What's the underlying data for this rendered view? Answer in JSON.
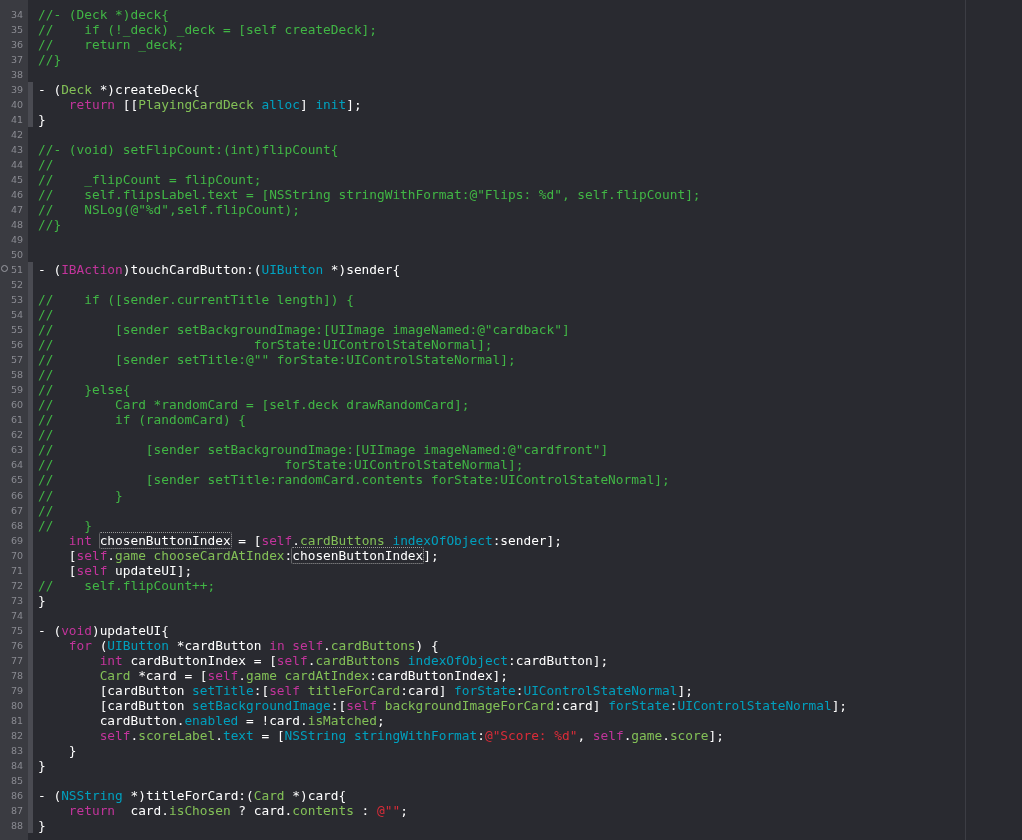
{
  "editor": {
    "lines": [
      {
        "number": "34",
        "marked": false,
        "dot": false,
        "tokens": [
          {
            "kind": "comment",
            "text": "//- (Deck *)deck{"
          }
        ]
      },
      {
        "number": "35",
        "marked": false,
        "dot": false,
        "tokens": [
          {
            "kind": "comment",
            "text": "//    if (!_deck) _deck = [self createDeck];"
          }
        ]
      },
      {
        "number": "36",
        "marked": false,
        "dot": false,
        "tokens": [
          {
            "kind": "comment",
            "text": "//    return _deck;"
          }
        ]
      },
      {
        "number": "37",
        "marked": false,
        "dot": false,
        "tokens": [
          {
            "kind": "comment",
            "text": "//}"
          }
        ]
      },
      {
        "number": "38",
        "marked": false,
        "dot": false
      },
      {
        "number": "39",
        "marked": true,
        "dot": false,
        "tokens": [
          {
            "kind": "plain",
            "text": "- ("
          },
          {
            "kind": "project",
            "text": "Deck"
          },
          {
            "kind": "plain",
            "text": " *)createDeck{"
          }
        ]
      },
      {
        "number": "40",
        "marked": true,
        "dot": false,
        "tokens": [
          {
            "kind": "keyword",
            "text": "    return"
          },
          {
            "kind": "plain",
            "text": " [["
          },
          {
            "kind": "project",
            "text": "PlayingCardDeck "
          },
          {
            "kind": "system",
            "text": "alloc"
          },
          {
            "kind": "plain",
            "text": "] "
          },
          {
            "kind": "system",
            "text": "init"
          },
          {
            "kind": "plain",
            "text": "];"
          }
        ]
      },
      {
        "number": "41",
        "marked": true,
        "dot": false,
        "tokens": [
          {
            "kind": "plain",
            "text": "}"
          }
        ]
      },
      {
        "number": "42",
        "marked": false,
        "dot": false
      },
      {
        "number": "43",
        "marked": false,
        "dot": false,
        "tokens": [
          {
            "kind": "comment",
            "text": "//- (void) setFlipCount:(int)flipCount{"
          }
        ]
      },
      {
        "number": "44",
        "marked": false,
        "dot": false,
        "tokens": [
          {
            "kind": "comment",
            "text": "//"
          }
        ]
      },
      {
        "number": "45",
        "marked": false,
        "dot": false,
        "tokens": [
          {
            "kind": "comment",
            "text": "//    _flipCount = flipCount;"
          }
        ]
      },
      {
        "number": "46",
        "marked": false,
        "dot": false,
        "tokens": [
          {
            "kind": "comment",
            "text": "//    self.flipsLabel.text = [NSString stringWithFormat:@\"Flips: %d\", self.flipCount];"
          }
        ]
      },
      {
        "number": "47",
        "marked": false,
        "dot": false,
        "tokens": [
          {
            "kind": "comment",
            "text": "//    NSLog(@\"%d\",self.flipCount);"
          }
        ]
      },
      {
        "number": "48",
        "marked": false,
        "dot": false,
        "tokens": [
          {
            "kind": "comment",
            "text": "//}"
          }
        ]
      },
      {
        "number": "49",
        "marked": false,
        "dot": false
      },
      {
        "number": "50",
        "marked": false,
        "dot": false
      },
      {
        "number": "51",
        "marked": true,
        "dot": true,
        "tokens": [
          {
            "kind": "plain",
            "text": "- ("
          },
          {
            "kind": "keyword",
            "text": "IBAction"
          },
          {
            "kind": "plain",
            "text": ")touchCardButton:("
          },
          {
            "kind": "system",
            "text": "UIButton"
          },
          {
            "kind": "plain",
            "text": " *)sender{"
          }
        ]
      },
      {
        "number": "52",
        "marked": true,
        "dot": false
      },
      {
        "number": "53",
        "marked": true,
        "dot": false,
        "tokens": [
          {
            "kind": "comment",
            "text": "//    if ([sender.currentTitle length]) {"
          }
        ]
      },
      {
        "number": "54",
        "marked": true,
        "dot": false,
        "tokens": [
          {
            "kind": "comment",
            "text": "//"
          }
        ]
      },
      {
        "number": "55",
        "marked": true,
        "dot": false,
        "tokens": [
          {
            "kind": "comment",
            "text": "//        [sender setBackgroundImage:[UIImage imageNamed:@\"cardback\"]"
          }
        ]
      },
      {
        "number": "56",
        "marked": true,
        "dot": false,
        "tokens": [
          {
            "kind": "comment",
            "text": "//                          forState:UIControlStateNormal];"
          }
        ]
      },
      {
        "number": "57",
        "marked": true,
        "dot": false,
        "tokens": [
          {
            "kind": "comment",
            "text": "//        [sender setTitle:@\"\" forState:UIControlStateNormal];"
          }
        ]
      },
      {
        "number": "58",
        "marked": true,
        "dot": false,
        "tokens": [
          {
            "kind": "comment",
            "text": "//"
          }
        ]
      },
      {
        "number": "59",
        "marked": true,
        "dot": false,
        "tokens": [
          {
            "kind": "comment",
            "text": "//    }else{"
          }
        ]
      },
      {
        "number": "60",
        "marked": true,
        "dot": false,
        "tokens": [
          {
            "kind": "comment",
            "text": "//        Card *randomCard = [self.deck drawRandomCard];"
          }
        ]
      },
      {
        "number": "61",
        "marked": true,
        "dot": false,
        "tokens": [
          {
            "kind": "comment",
            "text": "//        if (randomCard) {"
          }
        ]
      },
      {
        "number": "62",
        "marked": true,
        "dot": false,
        "tokens": [
          {
            "kind": "comment",
            "text": "//"
          }
        ]
      },
      {
        "number": "63",
        "marked": true,
        "dot": false,
        "tokens": [
          {
            "kind": "comment",
            "text": "//            [sender setBackgroundImage:[UIImage imageNamed:@\"cardfront\"]"
          }
        ]
      },
      {
        "number": "64",
        "marked": true,
        "dot": false,
        "tokens": [
          {
            "kind": "comment",
            "text": "//                              forState:UIControlStateNormal];"
          }
        ]
      },
      {
        "number": "65",
        "marked": true,
        "dot": false,
        "tokens": [
          {
            "kind": "comment",
            "text": "//            [sender setTitle:randomCard.contents forState:UIControlStateNormal];"
          }
        ]
      },
      {
        "number": "66",
        "marked": true,
        "dot": false,
        "tokens": [
          {
            "kind": "comment",
            "text": "//        }"
          }
        ]
      },
      {
        "number": "67",
        "marked": true,
        "dot": false,
        "tokens": [
          {
            "kind": "comment",
            "text": "//"
          }
        ]
      },
      {
        "number": "68",
        "marked": true,
        "dot": false,
        "tokens": [
          {
            "kind": "comment",
            "text": "//    }"
          }
        ]
      },
      {
        "number": "69",
        "marked": true,
        "dot": false,
        "tokens": [
          {
            "kind": "keyword",
            "text": "    int "
          },
          {
            "kind": "symbol",
            "text": "chosenButtonIndex"
          },
          {
            "kind": "plain",
            "text": " = ["
          },
          {
            "kind": "keyword",
            "text": "self"
          },
          {
            "kind": "plain",
            "text": "."
          },
          {
            "kind": "project",
            "text": "cardButtons "
          },
          {
            "kind": "system",
            "text": "indexOfObject"
          },
          {
            "kind": "plain",
            "text": ":sender];"
          }
        ]
      },
      {
        "number": "70",
        "marked": true,
        "dot": false,
        "tokens": [
          {
            "kind": "plain",
            "text": "    ["
          },
          {
            "kind": "keyword",
            "text": "self"
          },
          {
            "kind": "plain",
            "text": "."
          },
          {
            "kind": "project",
            "text": "game chooseCardAtIndex"
          },
          {
            "kind": "plain",
            "text": ":"
          },
          {
            "kind": "symbol",
            "text": "chosenButtonIndex"
          },
          {
            "kind": "plain",
            "text": "];"
          }
        ]
      },
      {
        "number": "71",
        "marked": true,
        "dot": false,
        "tokens": [
          {
            "kind": "plain",
            "text": "    ["
          },
          {
            "kind": "keyword",
            "text": "self"
          },
          {
            "kind": "plain",
            "text": " updateUI];"
          }
        ]
      },
      {
        "number": "72",
        "marked": true,
        "dot": false,
        "tokens": [
          {
            "kind": "comment",
            "text": "//    self.flipCount++;"
          }
        ]
      },
      {
        "number": "73",
        "marked": true,
        "dot": false,
        "tokens": [
          {
            "kind": "plain",
            "text": "}"
          }
        ]
      },
      {
        "number": "74",
        "marked": true,
        "dot": false
      },
      {
        "number": "75",
        "marked": true,
        "dot": false,
        "tokens": [
          {
            "kind": "plain",
            "text": "- ("
          },
          {
            "kind": "keyword",
            "text": "void"
          },
          {
            "kind": "plain",
            "text": ")updateUI{"
          }
        ]
      },
      {
        "number": "76",
        "marked": true,
        "dot": false,
        "tokens": [
          {
            "kind": "keyword",
            "text": "    for"
          },
          {
            "kind": "plain",
            "text": " ("
          },
          {
            "kind": "system",
            "text": "UIButton"
          },
          {
            "kind": "plain",
            "text": " *cardButton "
          },
          {
            "kind": "keyword",
            "text": "in self"
          },
          {
            "kind": "plain",
            "text": "."
          },
          {
            "kind": "project",
            "text": "cardButtons"
          },
          {
            "kind": "plain",
            "text": ") {"
          }
        ]
      },
      {
        "number": "77",
        "marked": true,
        "dot": false,
        "tokens": [
          {
            "kind": "keyword",
            "text": "        int"
          },
          {
            "kind": "plain",
            "text": " cardButtonIndex = ["
          },
          {
            "kind": "keyword",
            "text": "self"
          },
          {
            "kind": "plain",
            "text": "."
          },
          {
            "kind": "project",
            "text": "cardButtons "
          },
          {
            "kind": "system",
            "text": "indexOfObject"
          },
          {
            "kind": "plain",
            "text": ":cardButton];"
          }
        ]
      },
      {
        "number": "78",
        "marked": true,
        "dot": false,
        "tokens": [
          {
            "kind": "project",
            "text": "        Card"
          },
          {
            "kind": "plain",
            "text": " *card = ["
          },
          {
            "kind": "keyword",
            "text": "self"
          },
          {
            "kind": "plain",
            "text": "."
          },
          {
            "kind": "project",
            "text": "game cardAtIndex"
          },
          {
            "kind": "plain",
            "text": ":cardButtonIndex];"
          }
        ]
      },
      {
        "number": "79",
        "marked": true,
        "dot": false,
        "tokens": [
          {
            "kind": "plain",
            "text": "        [cardButton "
          },
          {
            "kind": "system",
            "text": "setTitle"
          },
          {
            "kind": "plain",
            "text": ":["
          },
          {
            "kind": "keyword",
            "text": "self "
          },
          {
            "kind": "project",
            "text": "titleForCard"
          },
          {
            "kind": "plain",
            "text": ":card] "
          },
          {
            "kind": "system",
            "text": "forState"
          },
          {
            "kind": "plain",
            "text": ":"
          },
          {
            "kind": "system",
            "text": "UIControlStateNormal"
          },
          {
            "kind": "plain",
            "text": "];"
          }
        ]
      },
      {
        "number": "80",
        "marked": true,
        "dot": false,
        "tokens": [
          {
            "kind": "plain",
            "text": "        [cardButton "
          },
          {
            "kind": "system",
            "text": "setBackgroundImage"
          },
          {
            "kind": "plain",
            "text": ":["
          },
          {
            "kind": "keyword",
            "text": "self "
          },
          {
            "kind": "project",
            "text": "backgroundImageForCard"
          },
          {
            "kind": "plain",
            "text": ":card] "
          },
          {
            "kind": "system",
            "text": "forState"
          },
          {
            "kind": "plain",
            "text": ":"
          },
          {
            "kind": "system",
            "text": "UIControlStateNormal"
          },
          {
            "kind": "plain",
            "text": "];"
          }
        ]
      },
      {
        "number": "81",
        "marked": true,
        "dot": false,
        "tokens": [
          {
            "kind": "plain",
            "text": "        cardButton."
          },
          {
            "kind": "system",
            "text": "enabled"
          },
          {
            "kind": "plain",
            "text": " = !card."
          },
          {
            "kind": "project",
            "text": "isMatched"
          },
          {
            "kind": "plain",
            "text": ";"
          }
        ]
      },
      {
        "number": "82",
        "marked": true,
        "dot": false,
        "tokens": [
          {
            "kind": "keyword",
            "text": "        self"
          },
          {
            "kind": "plain",
            "text": "."
          },
          {
            "kind": "project",
            "text": "scoreLabel"
          },
          {
            "kind": "plain",
            "text": "."
          },
          {
            "kind": "system",
            "text": "text"
          },
          {
            "kind": "plain",
            "text": " = ["
          },
          {
            "kind": "system",
            "text": "NSString stringWithFormat"
          },
          {
            "kind": "plain",
            "text": ":"
          },
          {
            "kind": "string",
            "text": "@\"Score: %d\""
          },
          {
            "kind": "plain",
            "text": ", "
          },
          {
            "kind": "keyword",
            "text": "self"
          },
          {
            "kind": "plain",
            "text": "."
          },
          {
            "kind": "project",
            "text": "game"
          },
          {
            "kind": "plain",
            "text": "."
          },
          {
            "kind": "project",
            "text": "score"
          },
          {
            "kind": "plain",
            "text": "];"
          }
        ]
      },
      {
        "number": "83",
        "marked": true,
        "dot": false,
        "tokens": [
          {
            "kind": "plain",
            "text": "    }"
          }
        ]
      },
      {
        "number": "84",
        "marked": true,
        "dot": false,
        "tokens": [
          {
            "kind": "plain",
            "text": "}"
          }
        ]
      },
      {
        "number": "85",
        "marked": true,
        "dot": false
      },
      {
        "number": "86",
        "marked": true,
        "dot": false,
        "tokens": [
          {
            "kind": "plain",
            "text": "- ("
          },
          {
            "kind": "system",
            "text": "NSString"
          },
          {
            "kind": "plain",
            "text": " *)titleForCard:("
          },
          {
            "kind": "project",
            "text": "Card"
          },
          {
            "kind": "plain",
            "text": " *)card{"
          }
        ]
      },
      {
        "number": "87",
        "marked": true,
        "dot": false,
        "tokens": [
          {
            "kind": "keyword",
            "text": "    return"
          },
          {
            "kind": "plain",
            "text": "  card."
          },
          {
            "kind": "project",
            "text": "isChosen"
          },
          {
            "kind": "plain",
            "text": " ? card."
          },
          {
            "kind": "project",
            "text": "contents"
          },
          {
            "kind": "plain",
            "text": " : "
          },
          {
            "kind": "string",
            "text": "@\"\""
          },
          {
            "kind": "plain",
            "text": ";"
          }
        ]
      },
      {
        "number": "88",
        "marked": true,
        "dot": false,
        "tokens": [
          {
            "kind": "plain",
            "text": "}"
          }
        ]
      }
    ]
  }
}
